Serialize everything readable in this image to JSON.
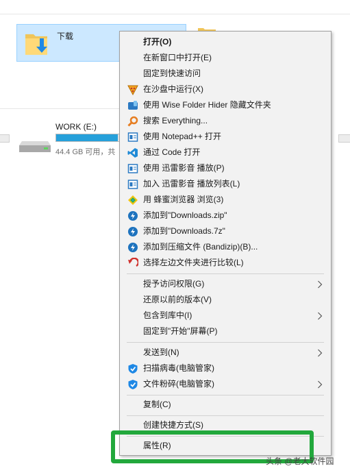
{
  "explorer": {
    "folder_downloads": {
      "label": "下载"
    },
    "drive": {
      "name": "WORK (E:)",
      "free_text": "44.4 GB 可用，共",
      "used_fraction": 0.97
    }
  },
  "menu": {
    "items": [
      {
        "label": "打开(O)",
        "bold": true,
        "icon": ""
      },
      {
        "label": "在新窗口中打开(E)",
        "icon": ""
      },
      {
        "label": "固定到快速访问",
        "icon": ""
      },
      {
        "label": "在沙盘中运行(X)",
        "icon": "sandbox-icon"
      },
      {
        "label": "使用 Wise Folder Hider 隐藏文件夹",
        "icon": "wise-folder-hider-icon"
      },
      {
        "label": "搜索 Everything...",
        "icon": "everything-search-icon"
      },
      {
        "label": "使用 Notepad++ 打开",
        "icon": "notepad-plus-plus-icon"
      },
      {
        "label": "通过 Code 打开",
        "icon": "vscode-icon"
      },
      {
        "label": "使用 迅雷影音 播放(P)",
        "icon": "xunlei-player-icon"
      },
      {
        "label": "加入 迅雷影音 播放列表(L)",
        "icon": "xunlei-playlist-icon"
      },
      {
        "label": "用 蜂蜜浏览器 浏览(3)",
        "icon": "honey-browser-icon"
      },
      {
        "label": "添加到\"Downloads.zip\"",
        "icon": "bandizip-icon"
      },
      {
        "label": "添加到\"Downloads.7z\"",
        "icon": "bandizip-icon"
      },
      {
        "label": "添加到压缩文件 (Bandizip)(B)...",
        "icon": "bandizip-icon"
      },
      {
        "label": "选择左边文件夹进行比较(L)",
        "icon": "compare-icon"
      },
      {
        "label": "授予访问权限(G)",
        "submenu": true
      },
      {
        "label": "还原以前的版本(V)"
      },
      {
        "label": "包含到库中(I)",
        "submenu": true
      },
      {
        "label": "固定到\"开始\"屏幕(P)"
      },
      {
        "label": "发送到(N)",
        "submenu": true
      },
      {
        "label": "扫描病毒(电脑管家)",
        "icon": "tencent-pc-manager-icon"
      },
      {
        "label": "文件粉碎(电脑管家)",
        "icon": "tencent-pc-manager-icon",
        "submenu": true
      },
      {
        "label": "复制(C)"
      },
      {
        "label": "创建快捷方式(S)"
      },
      {
        "label": "属性(R)"
      }
    ]
  },
  "watermark": "头条 @老大软件园",
  "colors": {
    "menu_bg": "#f2f2f2",
    "selection_bg": "#cce8ff",
    "highlight_green": "#22a83c",
    "drive_bar": "#26a0da"
  }
}
